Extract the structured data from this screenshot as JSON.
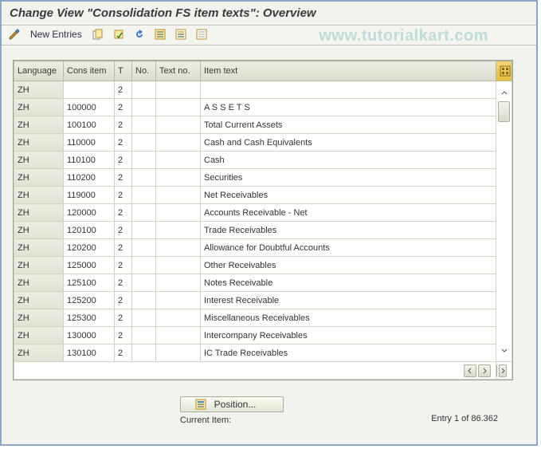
{
  "header": {
    "title": "Change View \"Consolidation FS item texts\": Overview"
  },
  "toolbar": {
    "new_entries": "New Entries"
  },
  "watermark": "www.tutorialkart.com",
  "grid": {
    "columns": {
      "language": "Language",
      "cons_item": "Cons item",
      "t": "T",
      "no": "No.",
      "text_no": "Text no.",
      "item_text": "Item text"
    },
    "rows": [
      {
        "language": "ZH",
        "cons_item": "",
        "t": "2",
        "no": "",
        "text_no": "",
        "item_text": ""
      },
      {
        "language": "ZH",
        "cons_item": "100000",
        "t": "2",
        "no": "",
        "text_no": "",
        "item_text": "A S S E T S"
      },
      {
        "language": "ZH",
        "cons_item": "100100",
        "t": "2",
        "no": "",
        "text_no": "",
        "item_text": "Total Current Assets"
      },
      {
        "language": "ZH",
        "cons_item": "110000",
        "t": "2",
        "no": "",
        "text_no": "",
        "item_text": "Cash and Cash Equivalents"
      },
      {
        "language": "ZH",
        "cons_item": "110100",
        "t": "2",
        "no": "",
        "text_no": "",
        "item_text": "Cash"
      },
      {
        "language": "ZH",
        "cons_item": "110200",
        "t": "2",
        "no": "",
        "text_no": "",
        "item_text": "Securities"
      },
      {
        "language": "ZH",
        "cons_item": "119000",
        "t": "2",
        "no": "",
        "text_no": "",
        "item_text": "Net Receivables"
      },
      {
        "language": "ZH",
        "cons_item": "120000",
        "t": "2",
        "no": "",
        "text_no": "",
        "item_text": "Accounts Receivable - Net"
      },
      {
        "language": "ZH",
        "cons_item": "120100",
        "t": "2",
        "no": "",
        "text_no": "",
        "item_text": "Trade Receivables"
      },
      {
        "language": "ZH",
        "cons_item": "120200",
        "t": "2",
        "no": "",
        "text_no": "",
        "item_text": "Allowance for Doubtful Accounts"
      },
      {
        "language": "ZH",
        "cons_item": "125000",
        "t": "2",
        "no": "",
        "text_no": "",
        "item_text": "Other Receivables"
      },
      {
        "language": "ZH",
        "cons_item": "125100",
        "t": "2",
        "no": "",
        "text_no": "",
        "item_text": "Notes Receivable"
      },
      {
        "language": "ZH",
        "cons_item": "125200",
        "t": "2",
        "no": "",
        "text_no": "",
        "item_text": "Interest Receivable"
      },
      {
        "language": "ZH",
        "cons_item": "125300",
        "t": "2",
        "no": "",
        "text_no": "",
        "item_text": "Miscellaneous Receivables"
      },
      {
        "language": "ZH",
        "cons_item": "130000",
        "t": "2",
        "no": "",
        "text_no": "",
        "item_text": "Intercompany Receivables"
      },
      {
        "language": "ZH",
        "cons_item": "130100",
        "t": "2",
        "no": "",
        "text_no": "",
        "item_text": "IC Trade Receivables"
      }
    ]
  },
  "footer": {
    "position_button": "Position...",
    "current_item_label": "Current Item:",
    "entry_count": "Entry 1 of 86.362"
  }
}
